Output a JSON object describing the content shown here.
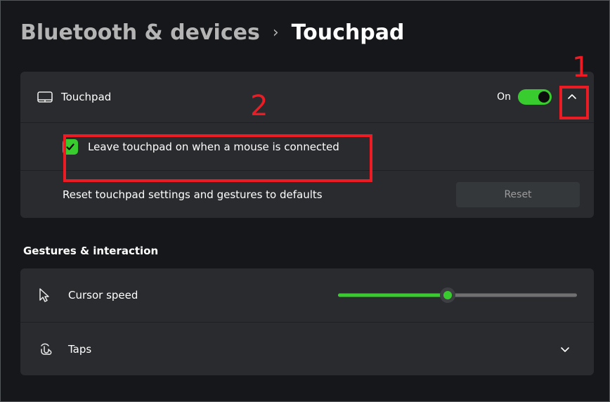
{
  "breadcrumb": {
    "parent": "Bluetooth & devices",
    "separator": "›",
    "current": "Touchpad"
  },
  "touchpad_panel": {
    "title": "Touchpad",
    "toggle_state": "On",
    "toggle_on": true,
    "leave_on_label": "Leave touchpad on when a mouse is connected",
    "leave_on_checked": true,
    "reset_label": "Reset touchpad settings and gestures to defaults",
    "reset_button": "Reset"
  },
  "section_heading": "Gestures & interaction",
  "gestures": {
    "cursor_speed_label": "Cursor speed",
    "cursor_speed_value": 0.46,
    "taps_label": "Taps"
  },
  "annotations": {
    "one": "1",
    "two": "2"
  },
  "colors": {
    "accent": "#39cc2f",
    "annotation": "#ed1c24",
    "panel": "#292b2e",
    "bg": "#15171a"
  }
}
